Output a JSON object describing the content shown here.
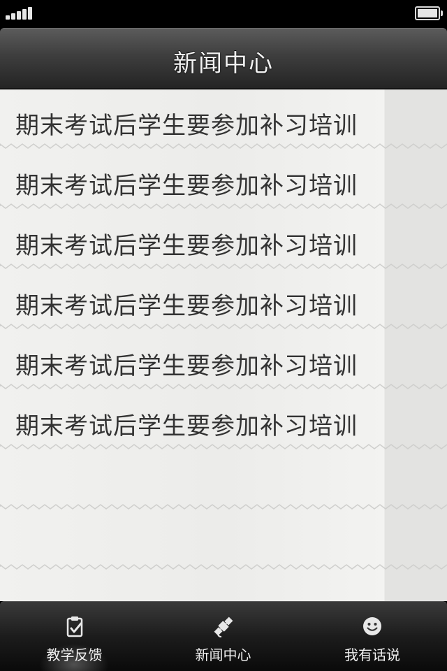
{
  "nav": {
    "title": "新闻中心"
  },
  "news": {
    "items": [
      "期末考试后学生要参加补习培训",
      "期末考试后学生要参加补习培训",
      "期末考试后学生要参加补习培训",
      "期末考试后学生要参加补习培训",
      "期末考试后学生要参加补习培训",
      "期末考试后学生要参加补习培训"
    ]
  },
  "tabs": [
    {
      "label": "教学反馈",
      "icon": "clipboard-check-icon",
      "selected": true
    },
    {
      "label": "新闻中心",
      "icon": "satellite-icon",
      "selected": false
    },
    {
      "label": "我有话说",
      "icon": "smiley-icon",
      "selected": false
    }
  ],
  "status": {
    "battery_level": 1.0,
    "signal_bars": 5
  },
  "colors": {
    "nav_bg": "#3e3e3e",
    "tab_bg": "#1c1c1c",
    "content_bg": "#efefed",
    "text": "#333333",
    "zigzag": "#cfcfcd"
  }
}
